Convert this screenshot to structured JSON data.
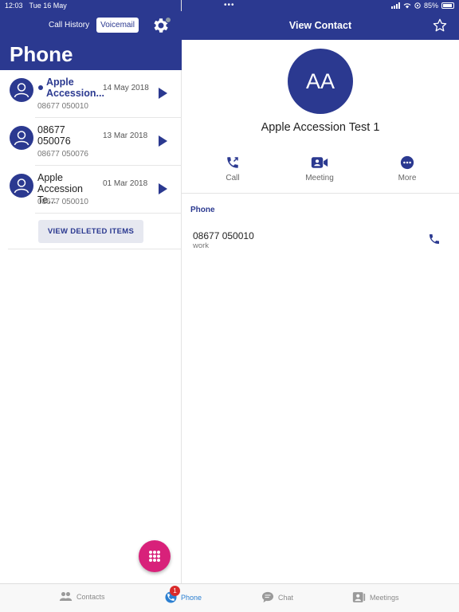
{
  "status_bar": {
    "time": "12:03",
    "date": "Tue 16 May",
    "battery": "85%"
  },
  "left": {
    "tabs": [
      {
        "label": "Call History"
      },
      {
        "label": "Voicemail",
        "active": true
      }
    ],
    "title": "Phone",
    "calls": [
      {
        "name": "Apple Accession...",
        "date": "14 May 2018",
        "number": "08677 050010",
        "unread": true
      },
      {
        "name": "08677 050076",
        "date": "13 Mar 2018",
        "number": "08677 050076",
        "unread": false
      },
      {
        "name": "Apple Accession Te...",
        "date": "01 Mar 2018",
        "number": "08677 050010",
        "unread": false
      }
    ],
    "view_deleted_label": "VIEW DELETED ITEMS"
  },
  "right": {
    "title": "View Contact",
    "initials": "AA",
    "contact_name": "Apple Accession Test 1",
    "actions": [
      {
        "label": "Call"
      },
      {
        "label": "Meeting"
      },
      {
        "label": "More"
      }
    ],
    "section_label": "Phone",
    "phone": {
      "number": "08677 050010",
      "type": "work"
    }
  },
  "tabbar": {
    "tabs": [
      {
        "label": "Contacts",
        "icon": "contacts-icon"
      },
      {
        "label": "Phone",
        "icon": "phone-icon",
        "badge": "1",
        "active": true
      },
      {
        "label": "Chat",
        "icon": "chat-icon"
      },
      {
        "label": "Meetings",
        "icon": "meetings-icon"
      }
    ]
  },
  "colors": {
    "brand": "#2b3990",
    "accent": "#d8217a",
    "tab_active": "#2b7fd1",
    "badge": "#d92b2b"
  }
}
